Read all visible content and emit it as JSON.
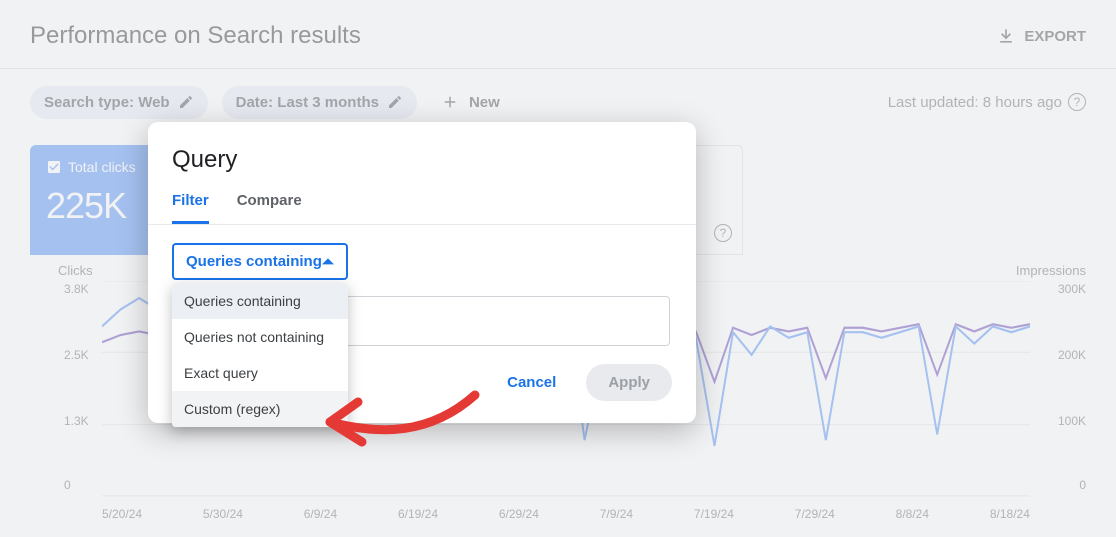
{
  "header": {
    "title": "Performance on Search results",
    "export_label": "EXPORT"
  },
  "filters": {
    "search_type": "Search type: Web",
    "date_range": "Date: Last 3 months",
    "new_label": "New",
    "last_updated": "Last updated: 8 hours ago"
  },
  "metric_card": {
    "label": "Total clicks",
    "value": "225K"
  },
  "modal": {
    "title": "Query",
    "tabs": {
      "filter": "Filter",
      "compare": "Compare"
    },
    "select_value": "Queries containing",
    "options": {
      "containing": "Queries containing",
      "not_containing": "Queries not containing",
      "exact": "Exact query",
      "regex": "Custom (regex)"
    },
    "cancel": "Cancel",
    "apply": "Apply"
  },
  "chart_data": {
    "type": "line",
    "xlabel": "",
    "left_axis": {
      "label": "Clicks",
      "ticks": [
        "3.8K",
        "2.5K",
        "1.3K",
        "0"
      ],
      "min": 0,
      "max": 3800
    },
    "right_axis": {
      "label": "Impressions",
      "ticks": [
        "300K",
        "200K",
        "100K",
        "0"
      ],
      "min": 0,
      "max": 300000
    },
    "x_ticks": [
      "5/20/24",
      "5/30/24",
      "6/9/24",
      "6/19/24",
      "6/29/24",
      "7/9/24",
      "7/19/24",
      "7/29/24",
      "8/8/24",
      "8/18/24"
    ],
    "series": [
      {
        "name": "Clicks",
        "axis": "left",
        "color": "#4285f4",
        "values": [
          3000,
          3300,
          3500,
          3300,
          1300,
          2400,
          2500,
          3200,
          1400,
          2400,
          2500,
          3200,
          1700,
          2400,
          2500,
          3200,
          1800,
          2400,
          2500,
          3100,
          2000,
          2800,
          2500,
          3000,
          2100,
          3500,
          1000,
          2600,
          2600,
          2500,
          2900,
          3200,
          2800,
          900,
          2900,
          2500,
          3000,
          2800,
          2900,
          1000,
          2900,
          2900,
          2800,
          2900,
          3000,
          1100,
          3000,
          2700,
          3000,
          2900,
          3000
        ]
      },
      {
        "name": "Impressions",
        "axis": "right",
        "color": "#5e35b1",
        "values": [
          215000,
          225000,
          230000,
          225000,
          170000,
          220000,
          225000,
          230000,
          175000,
          225000,
          225000,
          230000,
          180000,
          225000,
          230000,
          235000,
          185000,
          225000,
          230000,
          230000,
          190000,
          230000,
          225000,
          230000,
          195000,
          240000,
          165000,
          225000,
          225000,
          225000,
          230000,
          235000,
          230000,
          160000,
          235000,
          225000,
          235000,
          230000,
          235000,
          165000,
          235000,
          235000,
          230000,
          235000,
          240000,
          170000,
          240000,
          230000,
          240000,
          235000,
          240000
        ]
      }
    ]
  }
}
